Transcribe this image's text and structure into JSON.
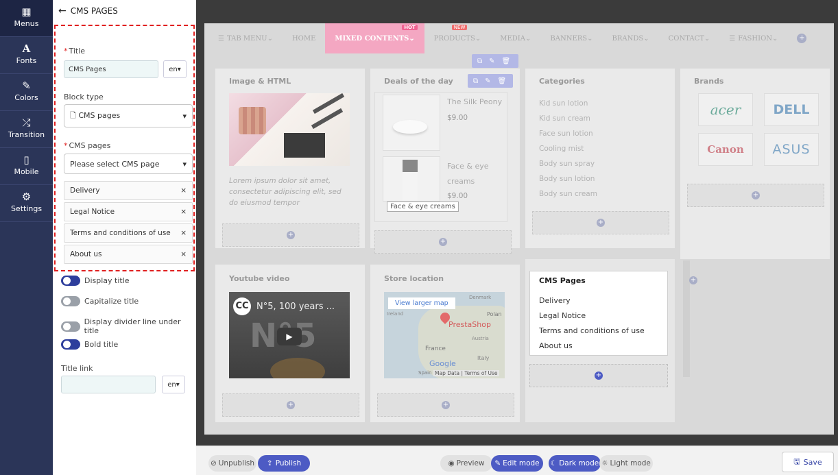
{
  "nav": [
    {
      "label": "Menus",
      "icon": "grid-icon"
    },
    {
      "label": "Fonts",
      "icon": "font-icon"
    },
    {
      "label": "Colors",
      "icon": "brush-icon"
    },
    {
      "label": "Transition",
      "icon": "shuffle-icon"
    },
    {
      "label": "Mobile",
      "icon": "mobile-icon"
    },
    {
      "label": "Settings",
      "icon": "gear-icon"
    }
  ],
  "panel": {
    "back_title": "CMS PAGES",
    "title_label": "Title",
    "title_value": "CMS Pages",
    "lang": "en",
    "block_type_label": "Block type",
    "block_type_value": "CMS pages",
    "cms_pages_label": "CMS pages",
    "cms_pages_placeholder": "Please select CMS page",
    "selected": [
      "Delivery",
      "Legal Notice",
      "Terms and conditions of use",
      "About us"
    ],
    "toggles": [
      {
        "label": "Display title",
        "on": true
      },
      {
        "label": "Capitalize title",
        "on": false
      },
      {
        "label": "Display divider line under title",
        "on": false
      },
      {
        "label": "Bold title",
        "on": true
      }
    ],
    "title_link_label": "Title link",
    "title_link_lang": "en"
  },
  "menubar": [
    {
      "label": "TAB MENU",
      "icon": "menu-icon",
      "caret": true
    },
    {
      "label": "HOME",
      "caret": false
    },
    {
      "label": "MIXED CONTENTS",
      "caret": true,
      "active": true,
      "badge": "HOT",
      "badge_color": "#f06292"
    },
    {
      "label": "PRODUCTS",
      "caret": true,
      "badge": "NEW",
      "badge_color": "#ef6c6c"
    },
    {
      "label": "MEDIA",
      "caret": true
    },
    {
      "label": "BANNERS",
      "caret": true
    },
    {
      "label": "BRANDS",
      "caret": true
    },
    {
      "label": "CONTACT",
      "caret": true
    },
    {
      "label": "FASHION",
      "icon": "menu-icon",
      "caret": true
    }
  ],
  "blocks": {
    "image_html": {
      "title": "Image & HTML",
      "text": "Lorem ipsum dolor sit amet, consectetur adipiscing elit, sed do eiusmod tempor"
    },
    "deals": {
      "title": "Deals of the day",
      "products": [
        {
          "name": "The Silk Peony",
          "price": "$9.00"
        },
        {
          "name": "Face & eye creams",
          "price": "$9.00"
        }
      ],
      "tooltip": "Face & eye creams"
    },
    "categories": {
      "title": "Categories",
      "items": [
        "Kid sun lotion",
        "Kid sun cream",
        "Face sun lotion",
        "Cooling mist",
        "Body sun spray",
        "Body sun lotion",
        "Body sun cream"
      ]
    },
    "brands": {
      "title": "Brands",
      "logos": [
        "acer",
        "DELL",
        "Canon",
        "ASUS"
      ]
    },
    "youtube": {
      "title": "Youtube video",
      "video_title": "N°5, 100 years ...",
      "big_text": "N°5"
    },
    "store": {
      "title": "Store location",
      "view_larger": "View larger map",
      "brand": "PrestaShop",
      "labels": [
        "Denmark",
        "Ireland",
        "Polan",
        "France",
        "Austria",
        "Italy",
        "Spain"
      ],
      "google": "Google",
      "map_data": "Map Data",
      "terms": "Terms of Use"
    },
    "cms_preview": {
      "title": "CMS Pages",
      "items": [
        "Delivery",
        "Legal Notice",
        "Terms and conditions of use",
        "About us"
      ]
    }
  },
  "bottom": {
    "unpublish": "Unpublish",
    "publish": "Publish",
    "preview": "Preview",
    "edit_mode": "Edit mode",
    "dark_mode": "Dark mode",
    "light_mode": "Light mode",
    "save": "Save"
  },
  "colors": {
    "nav_bg": "#2b3558",
    "accent": "#4d5bc4",
    "active_tab": "#f4a7c2",
    "required": "#e02020"
  }
}
